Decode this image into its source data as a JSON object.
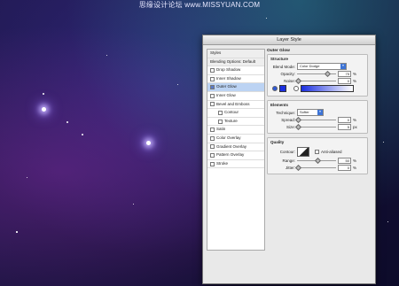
{
  "watermark": "思缘设计论坛 www.MISSYUAN.COM",
  "dialog": {
    "title": "Layer Style",
    "sidebar": [
      {
        "label": "Styles",
        "checked": false,
        "head": true
      },
      {
        "label": "Blending Options: Default",
        "checked": false,
        "head": true
      },
      {
        "label": "Drop Shadow",
        "checked": false
      },
      {
        "label": "Inner Shadow",
        "checked": false
      },
      {
        "label": "Outer Glow",
        "checked": true,
        "active": true
      },
      {
        "label": "Inner Glow",
        "checked": false
      },
      {
        "label": "Bevel and Emboss",
        "checked": false
      },
      {
        "label": "Contour",
        "checked": false,
        "indent": true
      },
      {
        "label": "Texture",
        "checked": false,
        "indent": true
      },
      {
        "label": "Satin",
        "checked": false
      },
      {
        "label": "Color Overlay",
        "checked": false
      },
      {
        "label": "Gradient Overlay",
        "checked": false
      },
      {
        "label": "Pattern Overlay",
        "checked": false
      },
      {
        "label": "Stroke",
        "checked": false
      }
    ],
    "panel": {
      "title": "Outer Glow",
      "structure": {
        "title": "Structure",
        "blend_mode_label": "Blend Mode:",
        "blend_mode_value": "Color Dodge",
        "opacity_label": "Opacity:",
        "opacity_value": "75",
        "opacity_level": 0.75,
        "noise_label": "Noise:",
        "noise_value": "0",
        "noise_level": 0.0,
        "percent": "%",
        "swatch_color": "#1b2fe0"
      },
      "elements": {
        "title": "Elements",
        "technique_label": "Technique:",
        "technique_value": "Softer",
        "spread_label": "Spread:",
        "spread_value": "0",
        "spread_level": 0.0,
        "size_label": "Size:",
        "size_value": "5",
        "size_level": 0.02,
        "percent": "%",
        "px": "px"
      },
      "quality": {
        "title": "Quality",
        "contour_label": "Contour:",
        "anti_aliased_label": "Anti-aliased",
        "range_label": "Range:",
        "range_value": "50",
        "range_level": 0.5,
        "jitter_label": "Jitter:",
        "jitter_value": "0",
        "jitter_level": 0.0,
        "percent": "%"
      }
    }
  }
}
